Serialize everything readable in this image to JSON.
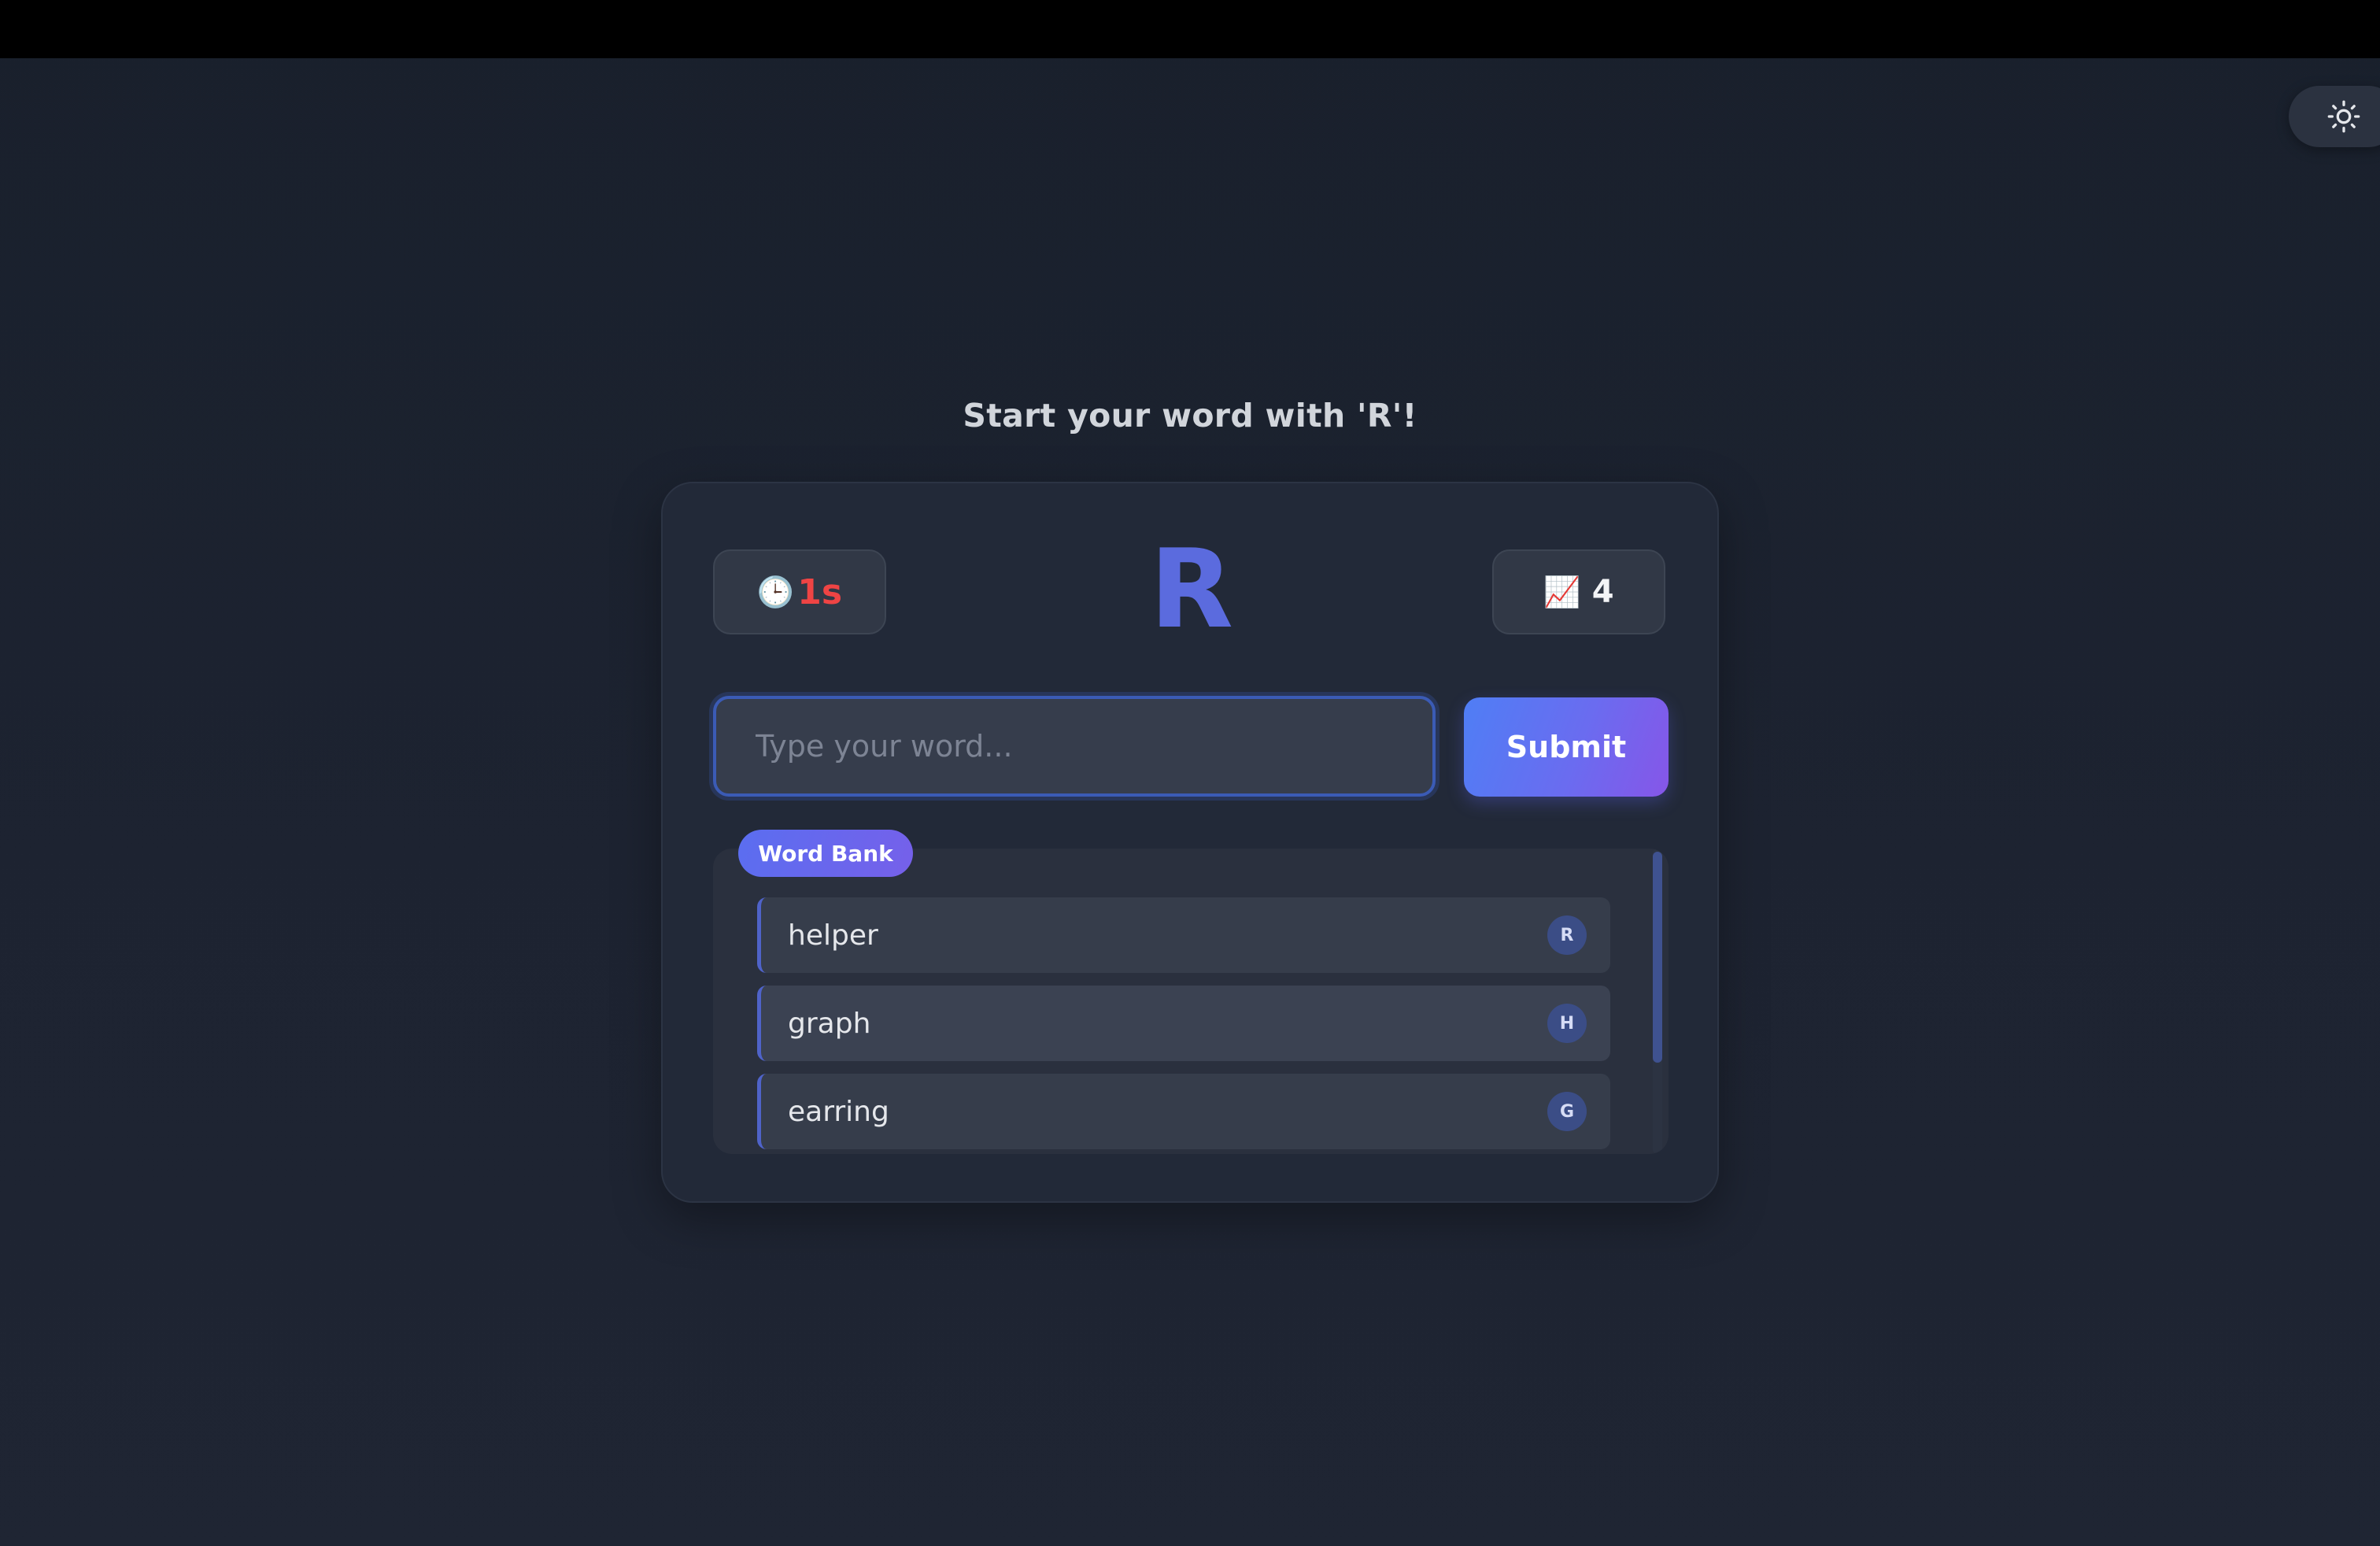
{
  "header": {
    "theme_toggle_icon": "sun-icon"
  },
  "prompt": {
    "title": "Start your word with 'R'!"
  },
  "game": {
    "timer": {
      "icon": "🕒",
      "value": "1s",
      "color": "#ef4444"
    },
    "letter": "R",
    "score": {
      "icon": "📈",
      "value": "4"
    }
  },
  "input": {
    "placeholder": "Type your word...",
    "value": ""
  },
  "submit": {
    "label": "Submit"
  },
  "word_bank": {
    "label": "Word Bank",
    "items": [
      {
        "word": "helper",
        "badge": "R"
      },
      {
        "word": "graph",
        "badge": "H"
      },
      {
        "word": "earring",
        "badge": "G"
      }
    ]
  },
  "colors": {
    "accent": "#5b6bde",
    "submit_gradient_start": "#4f7ef5",
    "submit_gradient_end": "#8656e8",
    "timer_text": "#ef4444"
  }
}
